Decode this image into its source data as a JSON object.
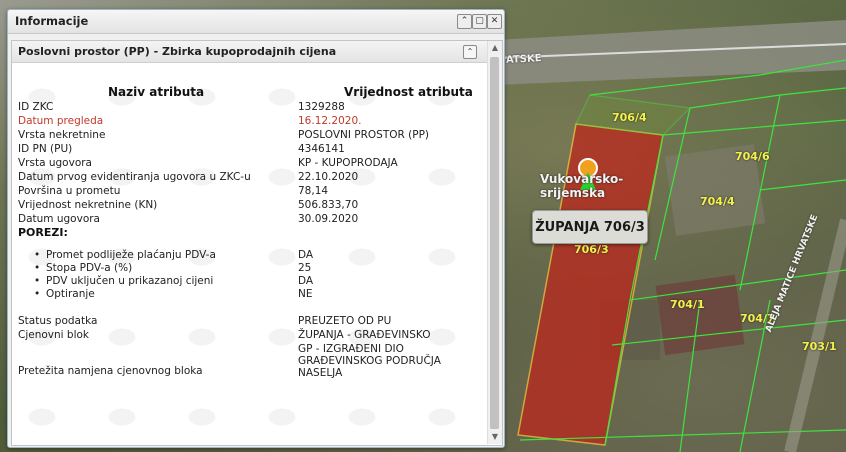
{
  "map": {
    "street_label": "ATSKE",
    "parcel_labels": [
      "706/4",
      "704/6",
      "704/4",
      "706/3",
      "704/1",
      "704/7",
      "703/1"
    ],
    "street_label_2": "ALEJA MATICE HRVATSKE",
    "marker_label": "Vukovarsko-srijemska",
    "tooltip": "ŽUPANJA 706/3",
    "highlight_color": "#c0241a",
    "parcel_line_color": "#3fe33f"
  },
  "panel": {
    "title": "Informacije",
    "buttons": {
      "collapse": "⌃",
      "maximize": "▢",
      "close": "✕"
    },
    "subpanel_title": "Poslovni prostor (PP) - Zbirka kupoprodajnih cijena",
    "column_headers": {
      "name": "Naziv atributa",
      "value": "Vrijednost atributa"
    },
    "rows": [
      {
        "name": "ID ZKC",
        "value": "1329288"
      },
      {
        "name": "Datum pregleda",
        "value": "16.12.2020."
      },
      {
        "name": "Vrsta nekretnine",
        "value": "POSLOVNI PROSTOR (PP)"
      },
      {
        "name": "ID PN (PU)",
        "value": "4346141"
      },
      {
        "name": "Vrsta ugovora",
        "value": "KP - KUPOPRODAJA"
      },
      {
        "name": "Datum prvog evidentiranja ugovora u ZKC-u",
        "value": "22.10.2020"
      },
      {
        "name": "Površina u prometu",
        "value": "78,14"
      },
      {
        "name": "Vrijednost nekretnine (KN)",
        "value": "506.833,70"
      },
      {
        "name": "Datum ugovora",
        "value": "30.09.2020"
      }
    ],
    "taxes_heading": "POREZI:",
    "taxes": [
      {
        "name": "Promet podliježe plaćanju PDV-a",
        "value": "DA"
      },
      {
        "name": "Stopa PDV-a (%)",
        "value": "25"
      },
      {
        "name": "PDV uključen u prikazanoj cijeni",
        "value": "DA"
      },
      {
        "name": "Optiranje",
        "value": "NE"
      }
    ],
    "extra_rows": [
      {
        "name": "Status podatka",
        "value": "PREUZETO OD PU"
      },
      {
        "name": "Cjenovni blok",
        "value": "ŽUPANJA - GRAĐEVINSKO"
      }
    ],
    "purpose_row": {
      "name": "Pretežita namjena cjenovnog bloka",
      "value": "GP - IZGRAĐENI DIO GRAĐEVINSKOG PODRUČJA NASELJA"
    }
  }
}
